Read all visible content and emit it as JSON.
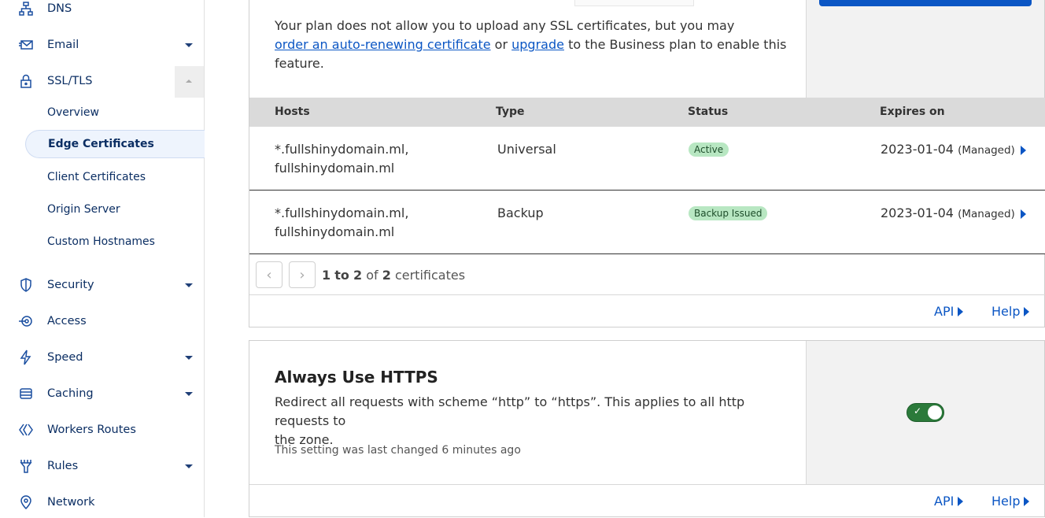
{
  "sidebar": {
    "items": [
      {
        "label": "DNS",
        "icon": "dns-icon"
      },
      {
        "label": "Email",
        "icon": "email-icon"
      },
      {
        "label": "SSL/TLS",
        "icon": "lock-icon"
      },
      {
        "label": "Security",
        "icon": "shield-icon"
      },
      {
        "label": "Access",
        "icon": "access-icon"
      },
      {
        "label": "Speed",
        "icon": "lightning-icon"
      },
      {
        "label": "Caching",
        "icon": "caching-icon"
      },
      {
        "label": "Workers Routes",
        "icon": "workers-icon"
      },
      {
        "label": "Rules",
        "icon": "rules-icon"
      },
      {
        "label": "Network",
        "icon": "location-pin-icon"
      }
    ],
    "ssl_sub_items": [
      {
        "label": "Overview"
      },
      {
        "label": "Edge Certificates"
      },
      {
        "label": "Client Certificates"
      },
      {
        "label": "Origin Server"
      },
      {
        "label": "Custom Hostnames"
      }
    ]
  },
  "certificates_card": {
    "text_before": "Your plan does not allow you to upload any SSL certificates, but you may",
    "link_order": "order an auto-renewing certificate",
    "text_or": "or",
    "link_upgrade": "upgrade",
    "text_after": "to the Business plan to enable this",
    "text_end": "feature.",
    "columns": [
      "Hosts",
      "Type",
      "Status",
      "Expires on"
    ],
    "rows": [
      {
        "host_line1": "*.fullshinydomain.ml,",
        "host_line2": "fullshinydomain.ml",
        "type": "Universal",
        "status": "Active",
        "expires": "2023-01-04",
        "managed": "(Managed)"
      },
      {
        "host_line1": "*.fullshinydomain.ml,",
        "host_line2": "fullshinydomain.ml",
        "type": "Backup",
        "status": "Backup Issued",
        "expires": "2023-01-04",
        "managed": "(Managed)"
      }
    ],
    "pagination": {
      "from": "1",
      "to_word": "to",
      "to": "2",
      "of_word": "of",
      "total": "2",
      "suffix": "certificates"
    },
    "api_label": "API",
    "help_label": "Help"
  },
  "https_card": {
    "title": "Always Use HTTPS",
    "description_line1": "Redirect all requests with scheme “http” to “https”. This applies to all http requests to",
    "description_line2": "the zone.",
    "last_changed": "This setting was last changed 6 minutes ago",
    "toggle_on": true,
    "api_label": "API",
    "help_label": "Help"
  },
  "colors": {
    "accent": "#0b56c4",
    "toggle_on": "#2b7a3a",
    "badge_bg": "#b8e7c2"
  }
}
